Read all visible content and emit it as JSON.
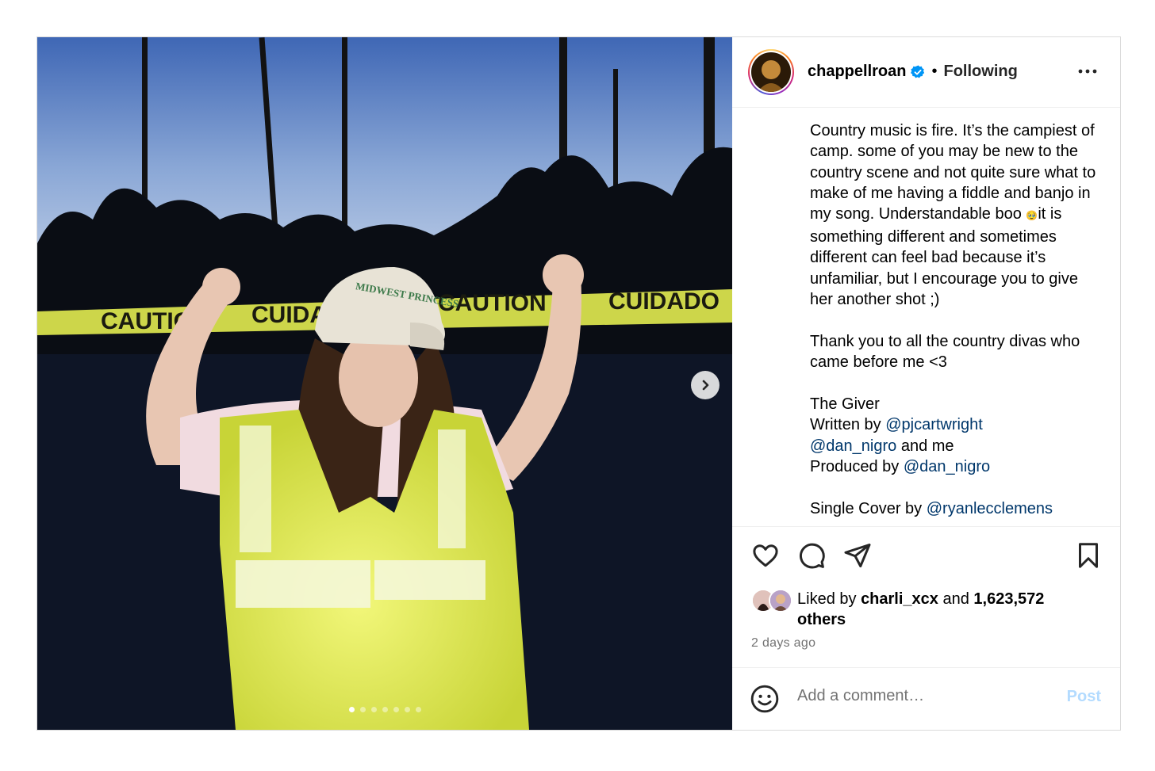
{
  "post": {
    "author": {
      "username": "chappellroan",
      "verified": true,
      "separator": "•",
      "follow_status": "Following"
    },
    "media": {
      "carousel_count": 7,
      "active_index": 0,
      "hat_text": "MIDWEST PRINCESS",
      "tape_texts": [
        "CAUTION",
        "CUIDA",
        "CAUTION",
        "CUIDADO"
      ]
    },
    "caption": {
      "line1": "Country music is fire. It’s the campiest of camp. some of you may be new to the country scene and not quite sure what to make of me having a fiddle and banjo in my song. Understandable boo ",
      "emoji": "🥹",
      "line1_end": "it is something different and sometimes different can feel bad because it’s unfamiliar, but I encourage you to give her another shot ;)",
      "thanks": "Thank you to all the country divas who came before me <3",
      "song_title": "The Giver",
      "written_by_prefix": "Written by ",
      "writer1": "@pjcartwright",
      "writer2": "@dan_nigro",
      "writers_suffix": " and me",
      "produced_by_prefix": "Produced by ",
      "producer": "@dan_nigro",
      "cover_prefix": "Single Cover by ",
      "cover_artist": "@ryanlecclemens"
    },
    "engagement": {
      "liked_by_prefix": "Liked by ",
      "liked_by_user": "charli_xcx",
      "and": " and ",
      "others_count": "1,623,572",
      "others_label": "others",
      "timestamp": "2 days ago"
    },
    "comment": {
      "placeholder": "Add a comment…",
      "post_label": "Post"
    },
    "icons": {
      "like": "heart-icon",
      "comment": "comment-icon",
      "share": "share-icon",
      "save": "bookmark-icon",
      "more": "more-icon",
      "emoji": "emoji-icon",
      "next": "chevron-right-icon",
      "verified": "verified-badge-icon"
    },
    "colors": {
      "link": "#00376b",
      "verified": "#0095f6",
      "post_disabled": "#b3dbff",
      "muted": "#737373"
    }
  }
}
